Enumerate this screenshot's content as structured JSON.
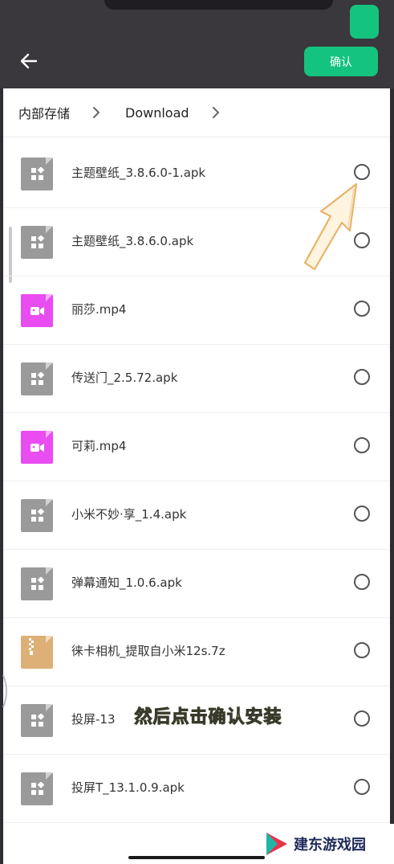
{
  "header": {
    "confirm_label": "确认"
  },
  "breadcrumb": {
    "items": [
      "内部存储",
      "Download"
    ]
  },
  "files": [
    {
      "name": "主题壁纸_3.8.6.0-1.apk",
      "type": "apk"
    },
    {
      "name": "主题壁纸_3.8.6.0.apk",
      "type": "apk"
    },
    {
      "name": "丽莎.mp4",
      "type": "mp4"
    },
    {
      "name": "传送门_2.5.72.apk",
      "type": "apk"
    },
    {
      "name": "可莉.mp4",
      "type": "mp4"
    },
    {
      "name": "小米不妙·享_1.4.apk",
      "type": "apk"
    },
    {
      "name": "弹幕通知_1.0.6.apk",
      "type": "apk"
    },
    {
      "name": "徕卡相机_提取自小米12s.7z",
      "type": "7z"
    },
    {
      "name": "投屏-13",
      "type": "apk"
    },
    {
      "name": "投屏T_13.1.0.9.apk",
      "type": "apk"
    }
  ],
  "caption": "然后点击确认安装",
  "watermark": "建东游戏园",
  "colors": {
    "accent": "#14c47e",
    "apk_icon": "#9a9a9a",
    "video_icon": "#e94cf0",
    "archive_icon": "#dcb076",
    "caption": "#f6f06a"
  },
  "icons": {
    "back": "arrow-left-icon",
    "breadcrumb_sep": "chevron-right-icon",
    "apk": "apk-file-icon",
    "mp4": "video-file-icon",
    "7z": "archive-file-icon"
  }
}
